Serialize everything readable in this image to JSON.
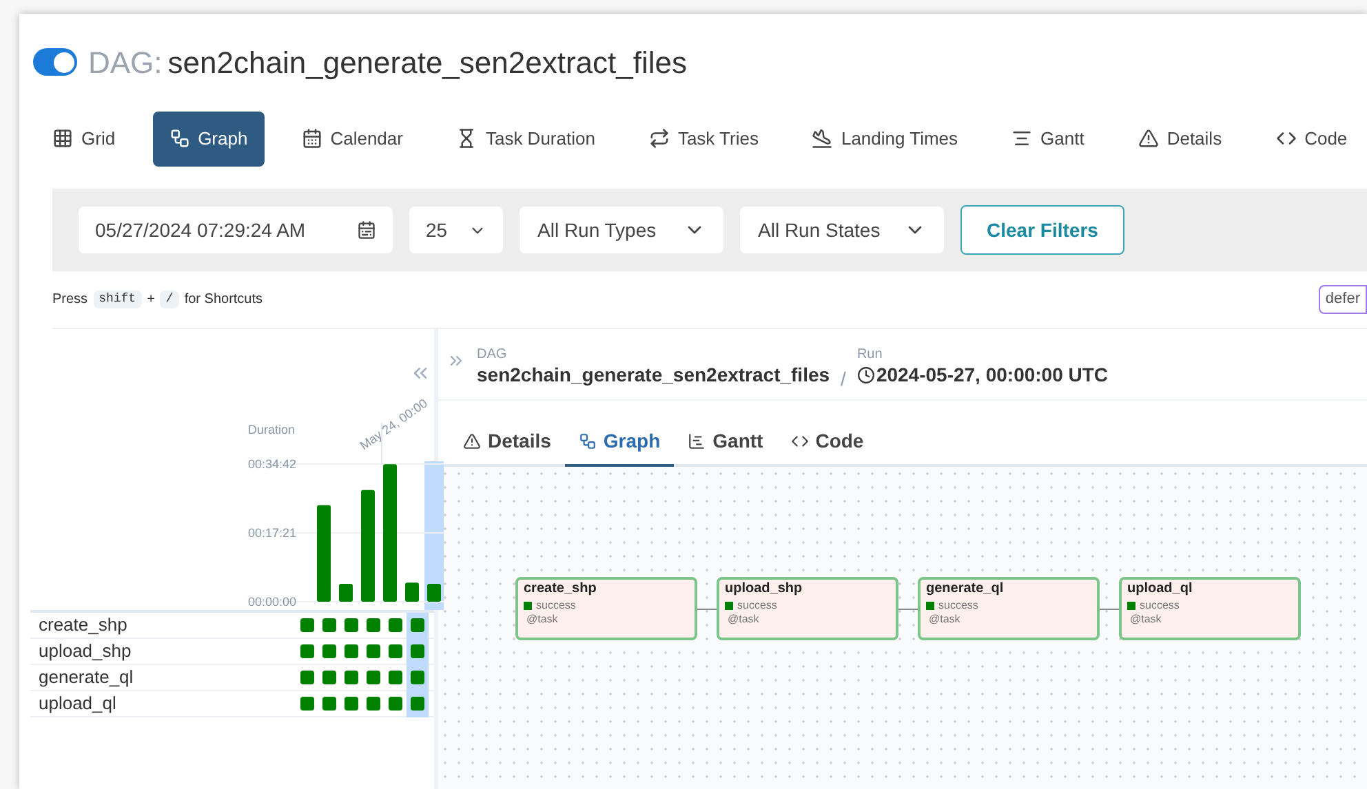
{
  "header": {
    "on": true,
    "prefix": "DAG:",
    "title": "sen2chain_generate_sen2extract_files"
  },
  "views": [
    {
      "label": "Grid",
      "selected": false
    },
    {
      "label": "Graph",
      "selected": true
    },
    {
      "label": "Calendar",
      "selected": false
    },
    {
      "label": "Task Duration",
      "selected": false
    },
    {
      "label": "Task Tries",
      "selected": false
    },
    {
      "label": "Landing Times",
      "selected": false
    },
    {
      "label": "Gantt",
      "selected": false
    },
    {
      "label": "Details",
      "selected": false
    },
    {
      "label": "Code",
      "selected": false
    }
  ],
  "filters": {
    "date": "05/27/2024 07:29:24 AM",
    "count": "25",
    "run_types": "All Run Types",
    "run_states": "All Run States",
    "clear": "Clear Filters"
  },
  "shortcuts": {
    "press": "Press",
    "key1": "shift",
    "plus": "+",
    "key2": "/",
    "rest": "for Shortcuts",
    "badge": "defer"
  },
  "grid": {
    "date_label": "May 24, 00:00",
    "chart_data": {
      "type": "bar",
      "ylabel": "Duration",
      "series": [
        {
          "color": "#008000",
          "values": [
            1460,
            270,
            1690,
            2080,
            290,
            270
          ]
        }
      ],
      "ylim": [
        0,
        2082
      ],
      "yticks": [
        {
          "value": 0,
          "label": "00:00:00"
        },
        {
          "value": 1041,
          "label": "00:17:21"
        },
        {
          "value": 2082,
          "label": "00:34:42"
        }
      ]
    },
    "columns": [
      {
        "selected": false
      },
      {
        "selected": false
      },
      {
        "selected": false
      },
      {
        "selected": false
      },
      {
        "selected": false
      },
      {
        "selected": true
      }
    ],
    "tasks": [
      {
        "name": "create_shp",
        "instances": [
          {
            "color": "#008000"
          },
          {
            "color": "#008000"
          },
          {
            "color": "#008000"
          },
          {
            "color": "#008000"
          },
          {
            "color": "#008000"
          },
          {
            "color": "#008000"
          }
        ]
      },
      {
        "name": "upload_shp",
        "instances": [
          {
            "color": "#008000"
          },
          {
            "color": "#008000"
          },
          {
            "color": "#008000"
          },
          {
            "color": "#008000"
          },
          {
            "color": "#008000"
          },
          {
            "color": "#008000"
          }
        ]
      },
      {
        "name": "generate_ql",
        "instances": [
          {
            "color": "#008000"
          },
          {
            "color": "#008000"
          },
          {
            "color": "#008000"
          },
          {
            "color": "#008000"
          },
          {
            "color": "#008000"
          },
          {
            "color": "#008000"
          }
        ]
      },
      {
        "name": "upload_ql",
        "instances": [
          {
            "color": "#008000"
          },
          {
            "color": "#008000"
          },
          {
            "color": "#008000"
          },
          {
            "color": "#008000"
          },
          {
            "color": "#008000"
          },
          {
            "color": "#008000"
          }
        ]
      }
    ]
  },
  "details": {
    "dag_label": "DAG",
    "dag": "sen2chain_generate_sen2extract_files",
    "separator": "/",
    "run_label": "Run",
    "run": "2024-05-27, 00:00:00 UTC",
    "tabs": [
      {
        "label": "Details",
        "selected": false
      },
      {
        "label": "Graph",
        "selected": true
      },
      {
        "label": "Gantt",
        "selected": false
      },
      {
        "label": "Code",
        "selected": false
      }
    ],
    "nodes": [
      {
        "name": "create_shp",
        "status": "success",
        "color": "#008000",
        "operator": "@task"
      },
      {
        "name": "upload_shp",
        "status": "success",
        "color": "#008000",
        "operator": "@task"
      },
      {
        "name": "generate_ql",
        "status": "success",
        "color": "#008000",
        "operator": "@task"
      },
      {
        "name": "upload_ql",
        "status": "success",
        "color": "#008000",
        "operator": "@task"
      }
    ]
  }
}
